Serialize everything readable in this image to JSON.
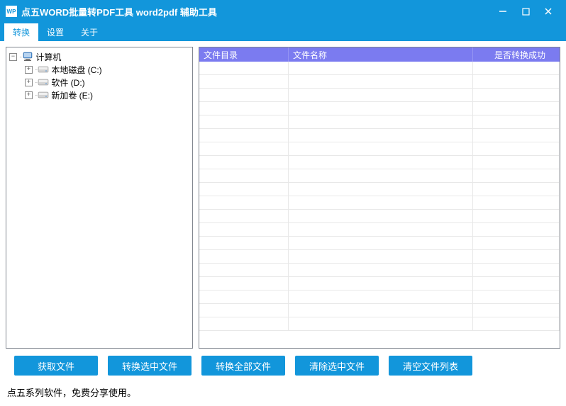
{
  "window": {
    "title": "点五WORD批量转PDF工具 word2pdf 辅助工具"
  },
  "menu": {
    "convert": "转换",
    "settings": "设置",
    "about": "关于"
  },
  "tree": {
    "root": "计算机",
    "drives": [
      {
        "label": "本地磁盘 (C:)"
      },
      {
        "label": "软件 (D:)"
      },
      {
        "label": "新加卷 (E:)"
      }
    ]
  },
  "table": {
    "headers": {
      "dir": "文件目录",
      "name": "文件名称",
      "status": "是否转换成功"
    }
  },
  "buttons": {
    "get_files": "获取文件",
    "convert_selected": "转换选中文件",
    "convert_all": "转换全部文件",
    "clear_selected": "清除选中文件",
    "clear_list": "清空文件列表"
  },
  "status": "点五系列软件，免费分享使用。"
}
